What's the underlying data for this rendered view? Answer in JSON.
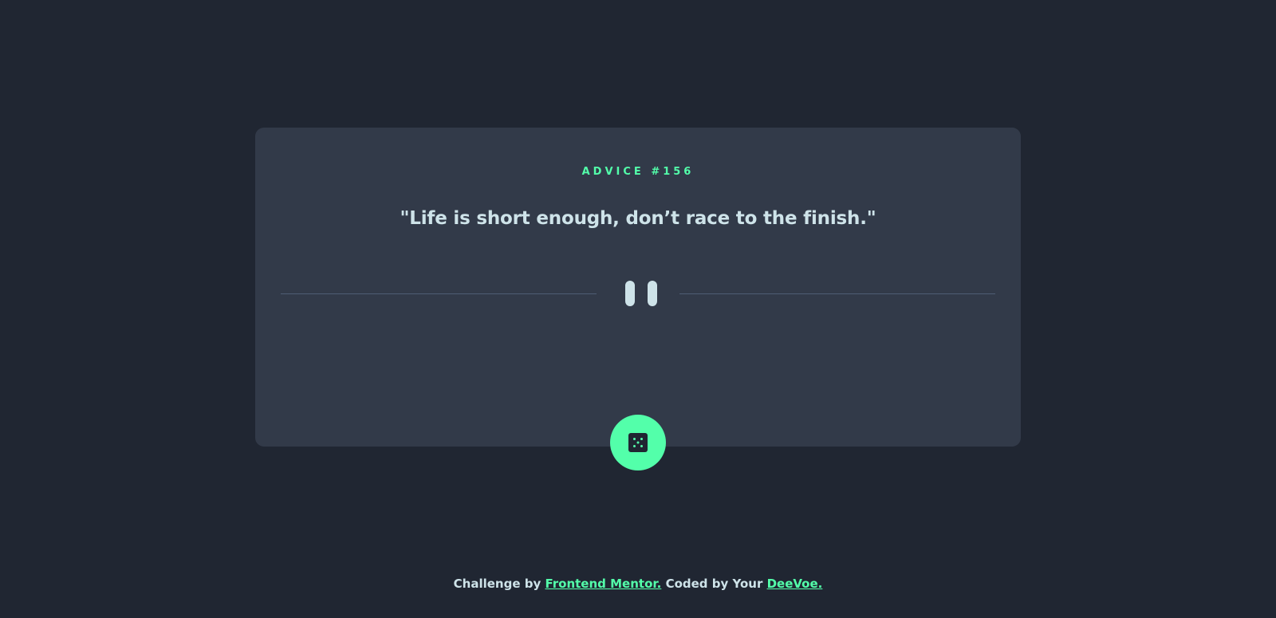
{
  "advice": {
    "label": "ADVICE #156",
    "quote": "\"Life is short enough, don’t race to the finish.\""
  },
  "divider": {
    "icon": "pause-icon"
  },
  "dice_button": {
    "icon": "dice-icon"
  },
  "footer": {
    "prefix": "Challenge by ",
    "link1": "Frontend Mentor.",
    "middle": " Coded by Your ",
    "link2": "DeeVoe."
  },
  "colors": {
    "background": "#202632",
    "card": "#323a49",
    "accent": "#53ffaa",
    "text": "#cee3e9",
    "divider": "#4f5d74"
  }
}
